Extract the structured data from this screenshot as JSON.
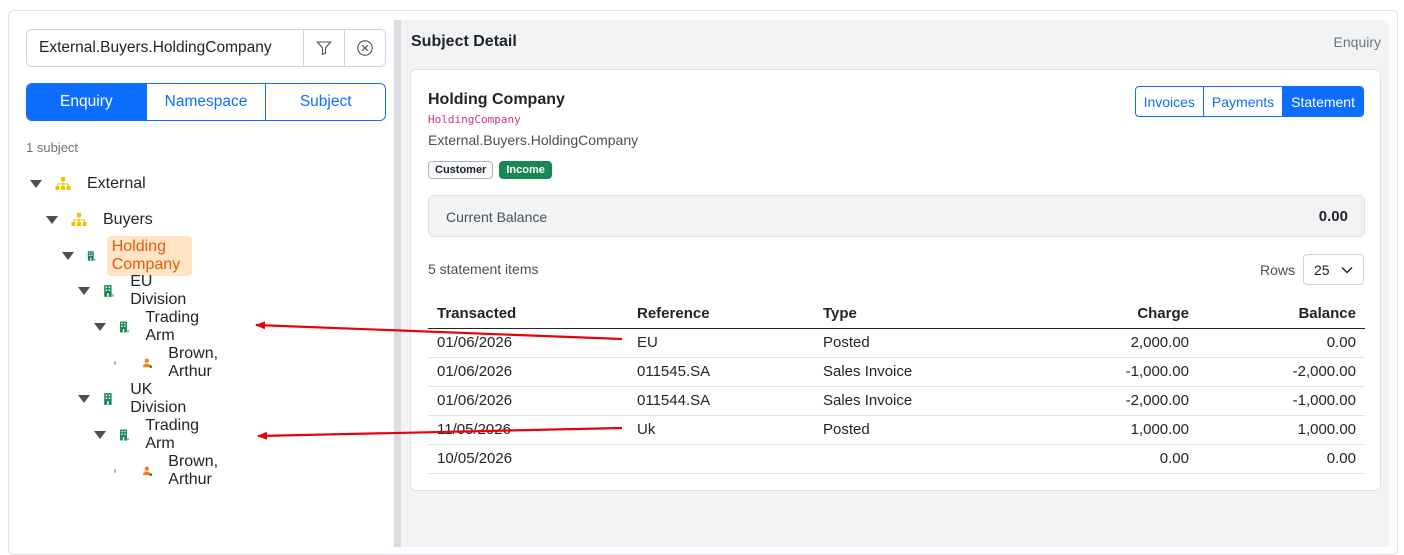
{
  "search": {
    "value": "External.Buyers.HoldingCompany"
  },
  "mode_tabs": [
    "Enquiry",
    "Namespace",
    "Subject"
  ],
  "subject_count": "1 subject",
  "tree": {
    "external": "External",
    "buyers": "Buyers",
    "holding": "Holding Company",
    "eu_division": "EU Division",
    "eu_trading_arm": "Trading Arm",
    "eu_person": "Brown, Arthur",
    "uk_division": "UK Division",
    "uk_trading_arm": "Trading Arm",
    "uk_person": "Brown, Arthur"
  },
  "detail": {
    "title": "Subject Detail",
    "mode": "Enquiry",
    "name": "Holding Company",
    "code": "HoldingCompany",
    "path": "External.Buyers.HoldingCompany",
    "badges": [
      "Customer",
      "Income"
    ],
    "tabs": [
      "Invoices",
      "Payments",
      "Statement"
    ],
    "active_tab": "Statement",
    "balance_label": "Current Balance",
    "balance_value": "0.00",
    "items_count": "5 statement items",
    "rows_label": "Rows",
    "rows_value": "25"
  },
  "statement": {
    "headers": [
      "Transacted",
      "Reference",
      "Type",
      "Charge",
      "Balance"
    ],
    "rows": [
      [
        "01/06/2026",
        "EU",
        "Posted",
        "2,000.00",
        "0.00"
      ],
      [
        "01/06/2026",
        "011545.SA",
        "Sales Invoice",
        "-1,000.00",
        "-2,000.00"
      ],
      [
        "01/06/2026",
        "011544.SA",
        "Sales Invoice",
        "-2,000.00",
        "-1,000.00"
      ],
      [
        "11/05/2026",
        "Uk",
        "Posted",
        "1,000.00",
        "1,000.00"
      ],
      [
        "10/05/2026",
        "",
        "",
        "0.00",
        "0.00"
      ]
    ]
  },
  "colors": {
    "accent": "#0d6efd",
    "selected_bg": "#ffe5c4",
    "selected_text": "#e8590c",
    "annotation": "#e8000b",
    "income": "#198754"
  }
}
